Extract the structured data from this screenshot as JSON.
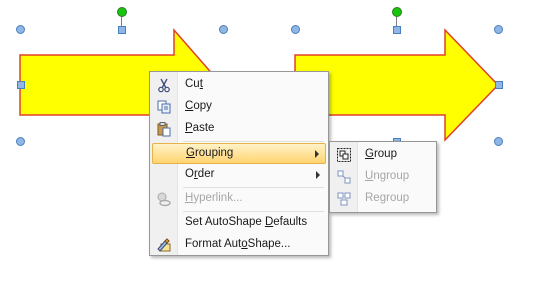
{
  "colors": {
    "arrow_fill": "#ffff00",
    "arrow_stroke": "#e0402a",
    "highlight_top": "#fff3c9",
    "highlight_bottom": "#ffd470",
    "disabled_text": "#a6a6a6"
  },
  "context_menu": {
    "items": [
      {
        "pre": "Cu",
        "key": "t",
        "post": "",
        "icon": "scissors-icon",
        "disabled": false
      },
      {
        "pre": "",
        "key": "C",
        "post": "opy",
        "icon": "copy-icon",
        "disabled": false
      },
      {
        "pre": "",
        "key": "P",
        "post": "aste",
        "icon": "paste-icon",
        "disabled": false
      },
      {
        "pre": "",
        "key": "G",
        "post": "rouping",
        "icon": "",
        "disabled": false,
        "submenu": true,
        "active": true
      },
      {
        "pre": "O",
        "key": "r",
        "post": "der",
        "icon": "",
        "disabled": false,
        "submenu": true
      },
      {
        "pre": "",
        "key": "H",
        "post": "yperlink...",
        "icon": "hyperlink-icon",
        "disabled": true
      },
      {
        "pre": "Set AutoShape ",
        "key": "D",
        "post": "efaults",
        "icon": "",
        "disabled": false
      },
      {
        "pre": "Format Aut",
        "key": "o",
        "post": "Shape...",
        "icon": "format-shape-icon",
        "disabled": false
      }
    ]
  },
  "grouping_submenu": {
    "items": [
      {
        "pre": "",
        "key": "G",
        "post": "roup",
        "icon": "group-icon",
        "disabled": false
      },
      {
        "pre": "",
        "key": "U",
        "post": "ngroup",
        "icon": "ungroup-icon",
        "disabled": true
      },
      {
        "pre": "Re",
        "key": "g",
        "post": "roup",
        "icon": "regroup-icon",
        "disabled": true
      }
    ]
  }
}
